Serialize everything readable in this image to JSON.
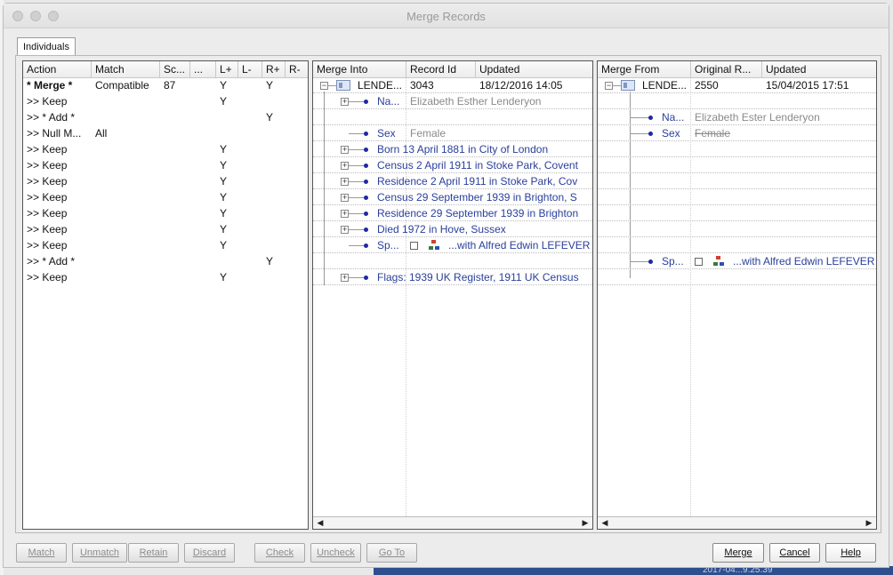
{
  "window": {
    "title": "Merge Records"
  },
  "tabs": {
    "individuals": "Individuals"
  },
  "actions": {
    "headers": [
      "Action",
      "Match",
      "Sc...",
      "...",
      "L+",
      "L-",
      "R+",
      "R-"
    ],
    "rows": [
      {
        "action": "* Merge *",
        "match": "Compatible",
        "score": "87",
        "lplus": "Y",
        "rplus": "Y",
        "bold": true
      },
      {
        "action": ">> Keep",
        "match": "",
        "score": "",
        "lplus": "Y",
        "rplus": ""
      },
      {
        "action": ">> * Add *",
        "match": "",
        "score": "",
        "lplus": "",
        "rplus": "Y"
      },
      {
        "action": ">> Null M...",
        "match": "All",
        "score": "",
        "lplus": "",
        "rplus": ""
      },
      {
        "action": ">> Keep",
        "match": "",
        "score": "",
        "lplus": "Y",
        "rplus": ""
      },
      {
        "action": ">> Keep",
        "match": "",
        "score": "",
        "lplus": "Y",
        "rplus": ""
      },
      {
        "action": ">> Keep",
        "match": "",
        "score": "",
        "lplus": "Y",
        "rplus": ""
      },
      {
        "action": ">> Keep",
        "match": "",
        "score": "",
        "lplus": "Y",
        "rplus": ""
      },
      {
        "action": ">> Keep",
        "match": "",
        "score": "",
        "lplus": "Y",
        "rplus": ""
      },
      {
        "action": ">> Keep",
        "match": "",
        "score": "",
        "lplus": "Y",
        "rplus": ""
      },
      {
        "action": ">> Keep",
        "match": "",
        "score": "",
        "lplus": "Y",
        "rplus": ""
      },
      {
        "action": ">> * Add *",
        "match": "",
        "score": "",
        "lplus": "",
        "rplus": "Y"
      },
      {
        "action": ">> Keep",
        "match": "",
        "score": "",
        "lplus": "Y",
        "rplus": ""
      }
    ]
  },
  "merge_into": {
    "headers": [
      "Merge Into",
      "Record Id",
      "Updated"
    ],
    "root": {
      "name": "LENDE...",
      "record_id": "3043",
      "updated": "18/12/2016 14:05"
    },
    "name_label": "Na...",
    "name_value": "Elizabeth Esther Lenderyon",
    "sex_label": "Sex",
    "sex_value": "Female",
    "facts": [
      "Born 13 April 1881 in City of London",
      "Census 2 April 1911 in Stoke Park, Covent",
      "Residence 2 April 1911 in Stoke Park, Cov",
      "Census 29 September 1939 in Brighton, S",
      "Residence 29 September 1939 in Brighton",
      "Died 1972 in Hove, Sussex"
    ],
    "spouse_label": "Sp...",
    "spouse_value": "...with Alfred Edwin LEFEVER",
    "flags": "Flags: 1939 UK Register, 1911 UK Census"
  },
  "merge_from": {
    "headers": [
      "Merge From",
      "Original R...",
      "Updated"
    ],
    "root": {
      "name": "LENDE...",
      "record_id": "2550",
      "updated": "15/04/2015 17:51"
    },
    "name_label": "Na...",
    "name_value": "Elizabeth Ester Lenderyon",
    "sex_label": "Sex",
    "sex_value": "Female",
    "spouse_label": "Sp...",
    "spouse_value": "...with Alfred Edwin LEFEVER"
  },
  "buttons": {
    "match": "Match",
    "unmatch": "Unmatch",
    "retain": "Retain",
    "discard": "Discard",
    "check": "Check",
    "uncheck": "Uncheck",
    "goto": "Go To",
    "merge": "Merge",
    "cancel": "Cancel",
    "help": "Help"
  },
  "background": {
    "clock": "2017-04...9.25.39"
  }
}
